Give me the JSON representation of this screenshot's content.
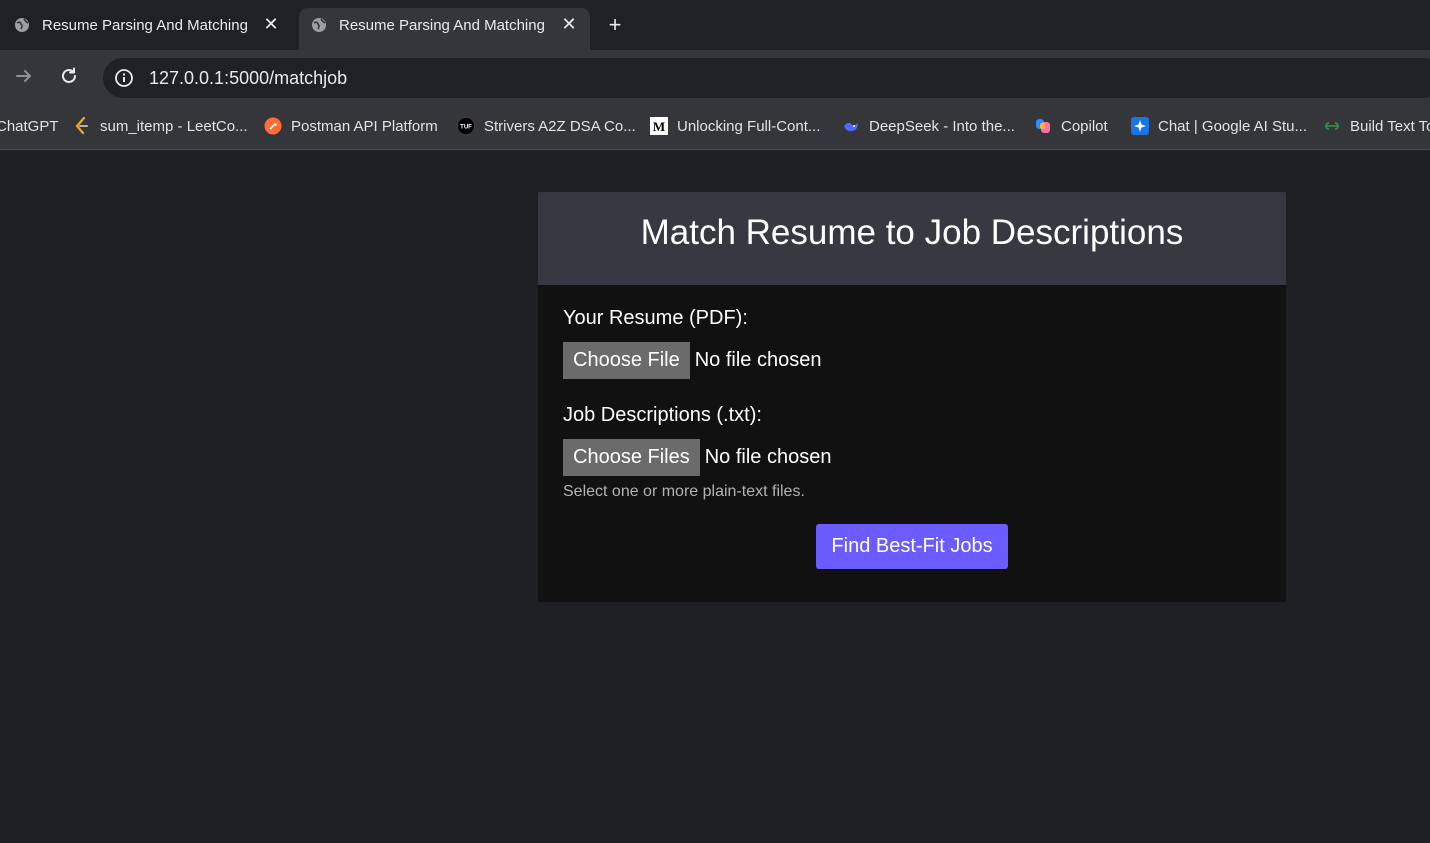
{
  "browser": {
    "tabs": [
      {
        "title": "Resume Parsing And Matching",
        "active": false
      },
      {
        "title": "Resume Parsing And Matching",
        "active": true
      }
    ],
    "url": "127.0.0.1:5000/matchjob",
    "bookmarks": [
      {
        "label": "ChatGPT",
        "icon": "none"
      },
      {
        "label": "sum_itemp - LeetCo...",
        "icon": "leetcode-icon"
      },
      {
        "label": "Postman API Platform",
        "icon": "postman-icon"
      },
      {
        "label": "Strivers A2Z DSA Co...",
        "icon": "tuf-icon"
      },
      {
        "label": "Unlocking Full-Cont...",
        "icon": "medium-icon"
      },
      {
        "label": "DeepSeek - Into the...",
        "icon": "deepseek-icon"
      },
      {
        "label": "Copilot",
        "icon": "copilot-icon"
      },
      {
        "label": "Chat | Google AI Stu...",
        "icon": "google-ai-studio-icon"
      },
      {
        "label": "Build Text To",
        "icon": "gfg-icon"
      }
    ]
  },
  "page": {
    "title": "Match Resume to Job Descriptions",
    "resume": {
      "label": "Your Resume (PDF):",
      "button": "Choose File",
      "status": "No file chosen"
    },
    "jobs": {
      "label": "Job Descriptions (.txt):",
      "button": "Choose Files",
      "status": "No file chosen",
      "hint": "Select one or more plain-text files."
    },
    "submit": "Find Best-Fit Jobs"
  },
  "colors": {
    "background": "#1f2023",
    "card": "#111111",
    "card_header": "#363941",
    "accent": "#6b5cff",
    "file_button": "#6b6b6b"
  }
}
